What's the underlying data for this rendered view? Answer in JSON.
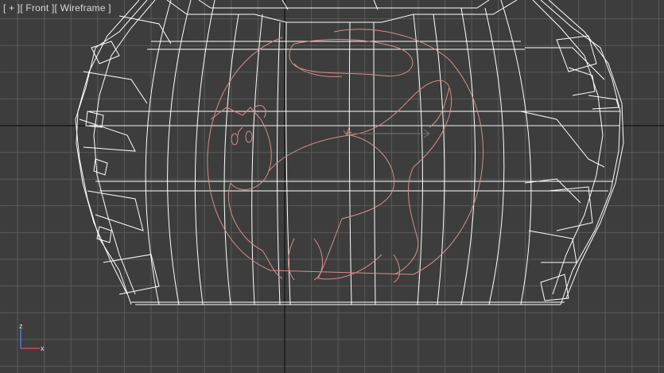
{
  "viewport": {
    "label": {
      "menu": "[ + ]",
      "view": "[ Front ]",
      "shading": "[ Wireframe ]"
    },
    "colors": {
      "background": "#3d3d3d",
      "grid": "#5a5a5a",
      "grid_axis": "#111111",
      "mesh": "#ffffff",
      "spline": "#d98c8c"
    },
    "gizmo": {
      "z": "z",
      "x": "x"
    }
  }
}
